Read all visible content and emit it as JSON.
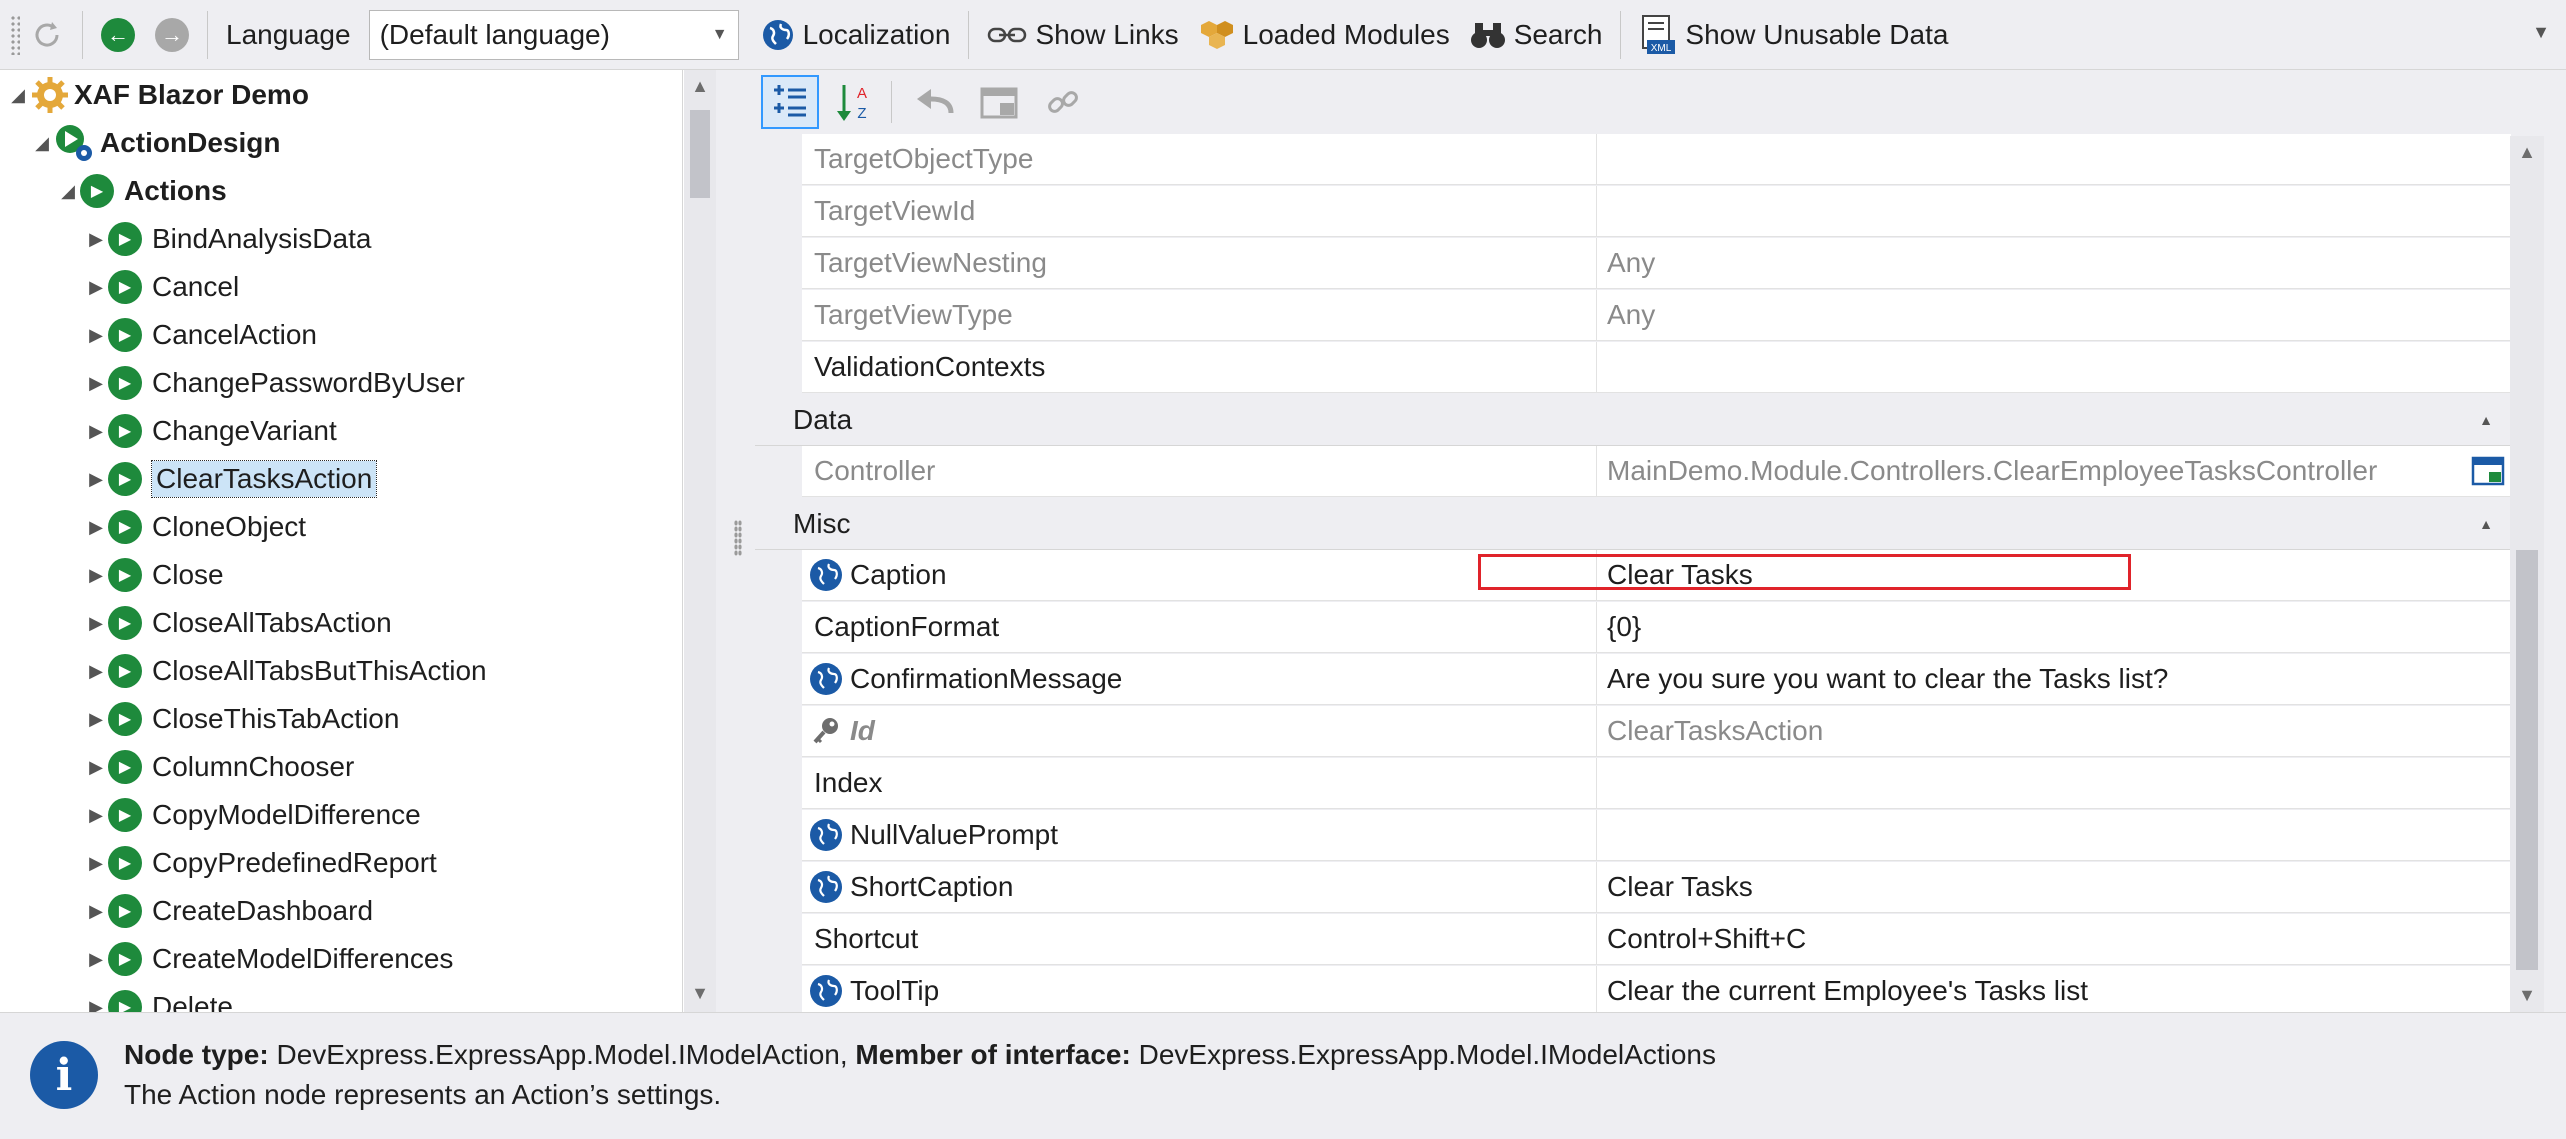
{
  "toolbar": {
    "language_label": "Language",
    "language_value": "(Default language)",
    "localization": "Localization",
    "show_links": "Show Links",
    "loaded_modules": "Loaded Modules",
    "search": "Search",
    "show_unusable": "Show Unusable Data",
    "xml_badge": "XML"
  },
  "tree": {
    "root": "XAF Blazor Demo",
    "level1": "ActionDesign",
    "level2": "Actions",
    "items": [
      "BindAnalysisData",
      "Cancel",
      "CancelAction",
      "ChangePasswordByUser",
      "ChangeVariant",
      "ClearTasksAction",
      "CloneObject",
      "Close",
      "CloseAllTabsAction",
      "CloseAllTabsButThisAction",
      "CloseThisTabAction",
      "ColumnChooser",
      "CopyModelDifference",
      "CopyPredefinedReport",
      "CreateDashboard",
      "CreateModelDifferences",
      "Delete"
    ],
    "selected": "ClearTasksAction"
  },
  "grid": {
    "rows_top": [
      {
        "name": "TargetObjectType",
        "value": "",
        "gray": true
      },
      {
        "name": "TargetViewId",
        "value": "",
        "gray": true
      },
      {
        "name": "TargetViewNesting",
        "value": "Any",
        "gray": true
      },
      {
        "name": "TargetViewType",
        "value": "Any",
        "gray": true
      },
      {
        "name": "ValidationContexts",
        "value": "",
        "gray": false
      }
    ],
    "cat_data": "Data",
    "data_rows": [
      {
        "name": "Controller",
        "value": "MainDemo.Module.Controllers.ClearEmployeeTasksController",
        "gray": true
      }
    ],
    "cat_misc": "Misc",
    "misc_rows": [
      {
        "name": "Caption",
        "value": "Clear Tasks",
        "icon": "globe"
      },
      {
        "name": "CaptionFormat",
        "value": "{0}",
        "icon": ""
      },
      {
        "name": "ConfirmationMessage",
        "value": "Are you sure you want to clear the Tasks list?",
        "icon": "globe"
      },
      {
        "name": "Id",
        "value": "ClearTasksAction",
        "icon": "key"
      },
      {
        "name": "Index",
        "value": "",
        "icon": ""
      },
      {
        "name": "NullValuePrompt",
        "value": "",
        "icon": "globe"
      },
      {
        "name": "ShortCaption",
        "value": "Clear Tasks",
        "icon": "globe"
      },
      {
        "name": "Shortcut",
        "value": "Control+Shift+C",
        "icon": ""
      },
      {
        "name": "ToolTip",
        "value": "Clear the current Employee's Tasks list",
        "icon": "globe"
      }
    ]
  },
  "status": {
    "node_type_label": "Node type:",
    "node_type_value": "DevExpress.ExpressApp.Model.IModelAction,",
    "member_label": "Member of interface:",
    "member_value": "DevExpress.ExpressApp.Model.IModelActions",
    "description": "The Action node represents an Action’s settings."
  },
  "colors": {
    "accent": "#1b5aa6",
    "action_green": "#1e8a3c",
    "highlight_red": "#e0232a",
    "selection": "#cce4f7"
  }
}
